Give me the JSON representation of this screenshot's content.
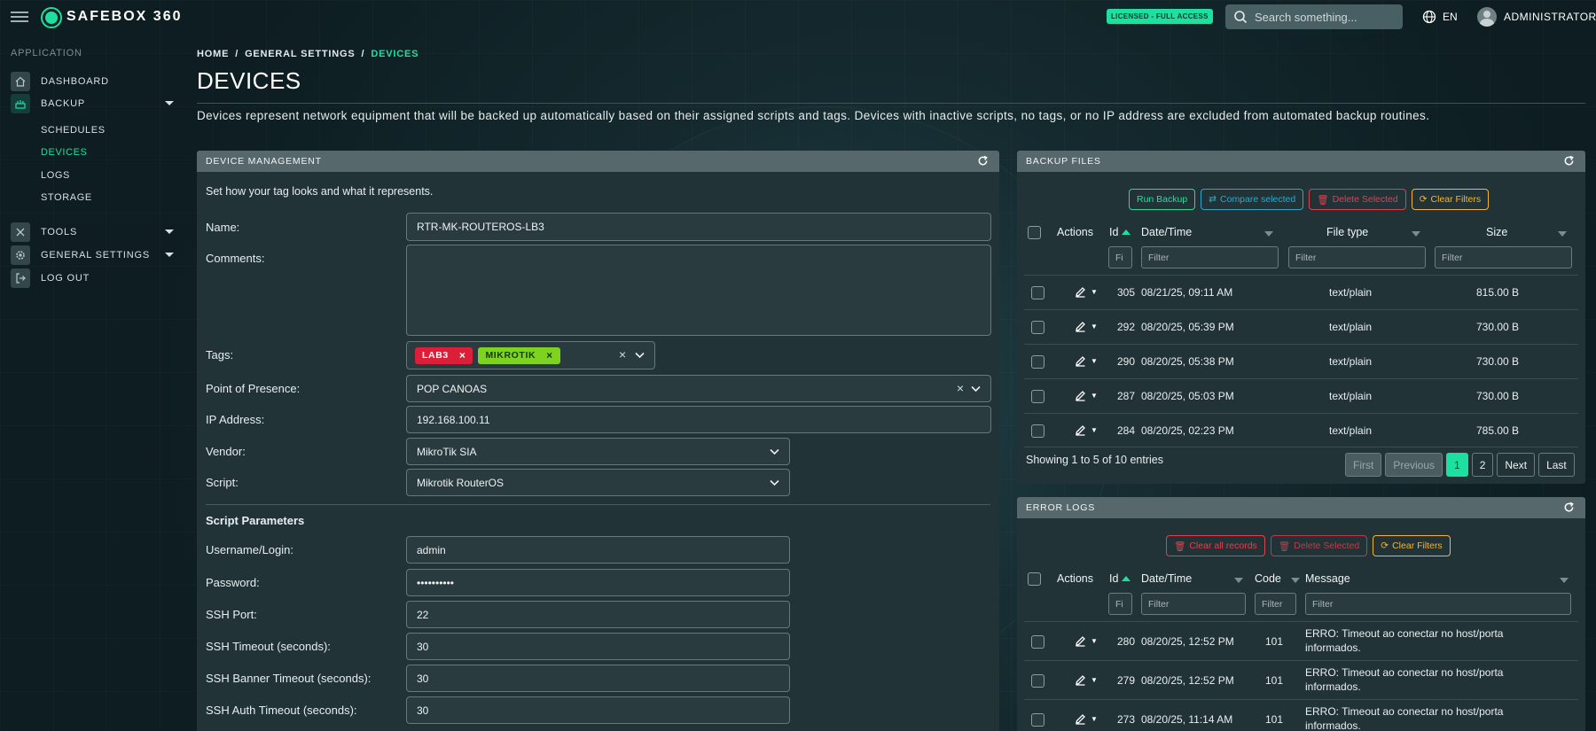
{
  "app": {
    "brand": "SAFEBOX 360",
    "license": "LICENSED - FULL ACCESS",
    "search_placeholder": "Search something...",
    "language": "EN",
    "user": "ADMINISTRATOR"
  },
  "sidebar": {
    "section": "APPLICATION",
    "items": [
      {
        "label": "DASHBOARD",
        "icon": "home-icon"
      },
      {
        "label": "BACKUP",
        "icon": "backup-icon"
      },
      {
        "label": "TOOLS",
        "icon": "tools-icon"
      },
      {
        "label": "GENERAL SETTINGS",
        "icon": "gear-icon"
      },
      {
        "label": "LOG OUT",
        "icon": "logout-icon"
      }
    ],
    "backup_sub": [
      "SCHEDULES",
      "DEVICES",
      "LOGS",
      "STORAGE"
    ]
  },
  "breadcrumb": {
    "home": "HOME",
    "settings": "GENERAL SETTINGS",
    "current": "DEVICES"
  },
  "page": {
    "title": "DEVICES",
    "description": "Devices represent network equipment that will be backed up automatically based on their assigned scripts and tags. Devices with inactive scripts, no tags, or no IP address are excluded from automated backup routines."
  },
  "device_form": {
    "header": "DEVICE MANAGEMENT",
    "subtitle": "Set how your tag looks and what it represents.",
    "name_label": "Name:",
    "name_value": "RTR-MK-ROUTEROS-LB3",
    "comments_label": "Comments:",
    "comments_value": "",
    "tags_label": "Tags:",
    "tags": [
      {
        "label": "LAB3",
        "color": "#dc1f38"
      },
      {
        "label": "MIKROTIK",
        "color": "#7ed321"
      }
    ],
    "pop_label": "Point of Presence:",
    "pop_value": "POP CANOAS",
    "ip_label": "IP Address:",
    "ip_value": "192.168.100.11",
    "vendor_label": "Vendor:",
    "vendor_value": "MikroTik SIA",
    "script_label": "Script:",
    "script_value": "Mikrotik RouterOS",
    "params_title": "Script Parameters",
    "username_label": "Username/Login:",
    "username_value": "admin",
    "password_label": "Password:",
    "password_value": "••••••••••",
    "ssh_port_label": "SSH Port:",
    "ssh_port_value": "22",
    "ssh_timeout_label": "SSH Timeout (seconds):",
    "ssh_timeout_value": "30",
    "ssh_banner_label": "SSH Banner Timeout (seconds):",
    "ssh_banner_value": "30",
    "ssh_auth_label": "SSH Auth Timeout (seconds):",
    "ssh_auth_value": "30"
  },
  "backup_files": {
    "header": "BACKUP FILES",
    "buttons": {
      "run": "Run Backup",
      "compare": "Compare selected",
      "delete": "Delete Selected",
      "clear": "Clear Filters"
    },
    "columns": {
      "actions": "Actions",
      "id": "Id",
      "datetime": "Date/Time",
      "filetype": "File type",
      "size": "Size"
    },
    "filter_id": "Fi",
    "filter": "Filter",
    "rows": [
      {
        "id": "305",
        "datetime": "08/21/25, 09:11 AM",
        "filetype": "text/plain",
        "size": "815.00 B"
      },
      {
        "id": "292",
        "datetime": "08/20/25, 05:39 PM",
        "filetype": "text/plain",
        "size": "730.00 B"
      },
      {
        "id": "290",
        "datetime": "08/20/25, 05:38 PM",
        "filetype": "text/plain",
        "size": "730.00 B"
      },
      {
        "id": "287",
        "datetime": "08/20/25, 05:03 PM",
        "filetype": "text/plain",
        "size": "730.00 B"
      },
      {
        "id": "284",
        "datetime": "08/20/25, 02:23 PM",
        "filetype": "text/plain",
        "size": "785.00 B"
      }
    ],
    "info": "Showing 1 to 5 of 10 entries",
    "pager": {
      "first": "First",
      "previous": "Previous",
      "p1": "1",
      "p2": "2",
      "next": "Next",
      "last": "Last"
    }
  },
  "error_logs": {
    "header": "ERROR LOGS",
    "buttons": {
      "clear_all": "Clear all records",
      "delete": "Delete Selected",
      "clear": "Clear Filters"
    },
    "columns": {
      "actions": "Actions",
      "id": "Id",
      "datetime": "Date/Time",
      "code": "Code",
      "message": "Message"
    },
    "filter_id": "Fi",
    "filter": "Filter",
    "rows": [
      {
        "id": "280",
        "datetime": "08/20/25, 12:52 PM",
        "code": "101",
        "msg1": "ERRO: Timeout ao conectar no host/porta",
        "msg2": "informados."
      },
      {
        "id": "279",
        "datetime": "08/20/25, 12:52 PM",
        "code": "101",
        "msg1": "ERRO: Timeout ao conectar no host/porta",
        "msg2": "informados."
      },
      {
        "id": "273",
        "datetime": "08/20/25, 11:14 AM",
        "code": "101",
        "msg1": "ERRO: Timeout ao conectar no host/porta",
        "msg2": "informados."
      }
    ]
  },
  "colors": {
    "accent": "#1de0a0",
    "danger": "#e0414f",
    "warning": "#f2b632",
    "info": "#2ba8c9"
  }
}
